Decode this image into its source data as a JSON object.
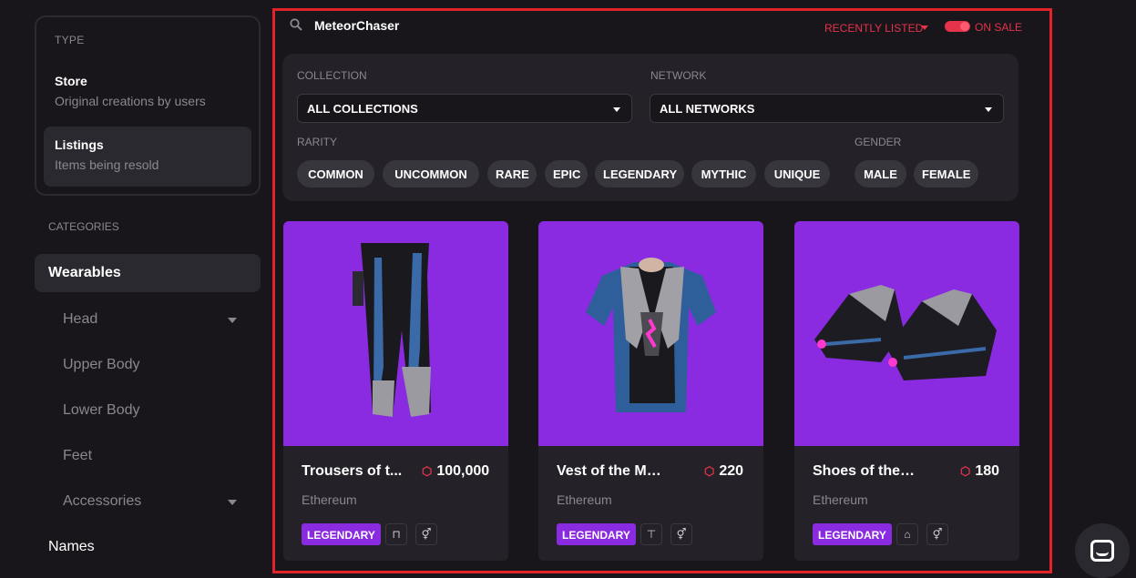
{
  "sidebar": {
    "type_heading": "TYPE",
    "type_items": [
      {
        "title": "Store",
        "desc": "Original creations by users"
      },
      {
        "title": "Listings",
        "desc": "Items being resold"
      }
    ],
    "categories_heading": "CATEGORIES",
    "wearables": "Wearables",
    "sub_items": [
      "Head",
      "Upper Body",
      "Lower Body",
      "Feet",
      "Accessories"
    ],
    "names": "Names"
  },
  "search": {
    "value": "MeteorChaser"
  },
  "sort": {
    "label": "RECENTLY LISTED"
  },
  "on_sale": {
    "label": "ON SALE",
    "enabled": true
  },
  "filters": {
    "collection_label": "COLLECTION",
    "collection_value": "ALL COLLECTIONS",
    "network_label": "NETWORK",
    "network_value": "ALL NETWORKS",
    "rarity_label": "RARITY",
    "rarities": [
      "COMMON",
      "UNCOMMON",
      "RARE",
      "EPIC",
      "LEGENDARY",
      "MYTHIC",
      "UNIQUE"
    ],
    "gender_label": "GENDER",
    "genders": [
      "MALE",
      "FEMALE"
    ]
  },
  "cards": [
    {
      "name": "Trousers of t...",
      "price": "100,000",
      "network": "Ethereum",
      "rarity": "LEGENDARY",
      "category_icon": "trousers-icon"
    },
    {
      "name": "Vest of the Mete...",
      "price": "220",
      "network": "Ethereum",
      "rarity": "LEGENDARY",
      "category_icon": "upper-body-icon"
    },
    {
      "name": "Shoes of the met...",
      "price": "180",
      "network": "Ethereum",
      "rarity": "LEGENDARY",
      "category_icon": "shoe-icon"
    }
  ],
  "colors": {
    "accent": "#e4334a",
    "legendary": "#8a2be2",
    "highlight_border": "#e3232a"
  }
}
